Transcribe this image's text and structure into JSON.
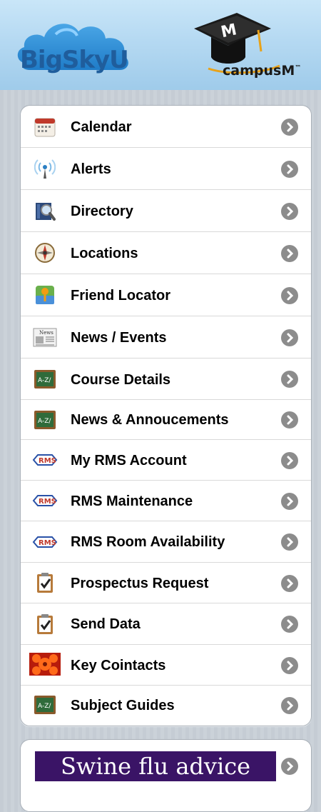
{
  "header": {
    "brand_left": {
      "part1": "BigSky",
      "part2": "U"
    },
    "brand_right": "campusM",
    "brand_right_tm": "™"
  },
  "menu": {
    "items": [
      {
        "label": "Calendar",
        "icon": "calendar-icon"
      },
      {
        "label": "Alerts",
        "icon": "alerts-icon"
      },
      {
        "label": "Directory",
        "icon": "directory-icon"
      },
      {
        "label": "Locations",
        "icon": "compass-icon"
      },
      {
        "label": "Friend Locator",
        "icon": "friend-locator-icon"
      },
      {
        "label": "News / Events",
        "icon": "newspaper-icon"
      },
      {
        "label": "Course Details",
        "icon": "chalkboard-icon"
      },
      {
        "label": "News & Annoucements",
        "icon": "chalkboard-icon"
      },
      {
        "label": "My RMS Account",
        "icon": "rms-icon"
      },
      {
        "label": "RMS Maintenance",
        "icon": "rms-icon"
      },
      {
        "label": "RMS Room Availability",
        "icon": "rms-icon"
      },
      {
        "label": "Prospectus Request",
        "icon": "clipboard-check-icon"
      },
      {
        "label": "Send Data",
        "icon": "clipboard-check-icon"
      },
      {
        "label": "Key Cointacts",
        "icon": "flower-icon"
      },
      {
        "label": "Subject Guides",
        "icon": "chalkboard-icon"
      }
    ],
    "chalkboard_text": "A-Z/",
    "rms_text": "RMS",
    "news_text": "News"
  },
  "banner": {
    "label": "Swine flu advice"
  },
  "colors": {
    "header_sky": "#b5d9f2",
    "brand_blue": "#1f5d9c",
    "chevron_gray": "#8c8c8c",
    "banner_purple": "#3a1466"
  }
}
